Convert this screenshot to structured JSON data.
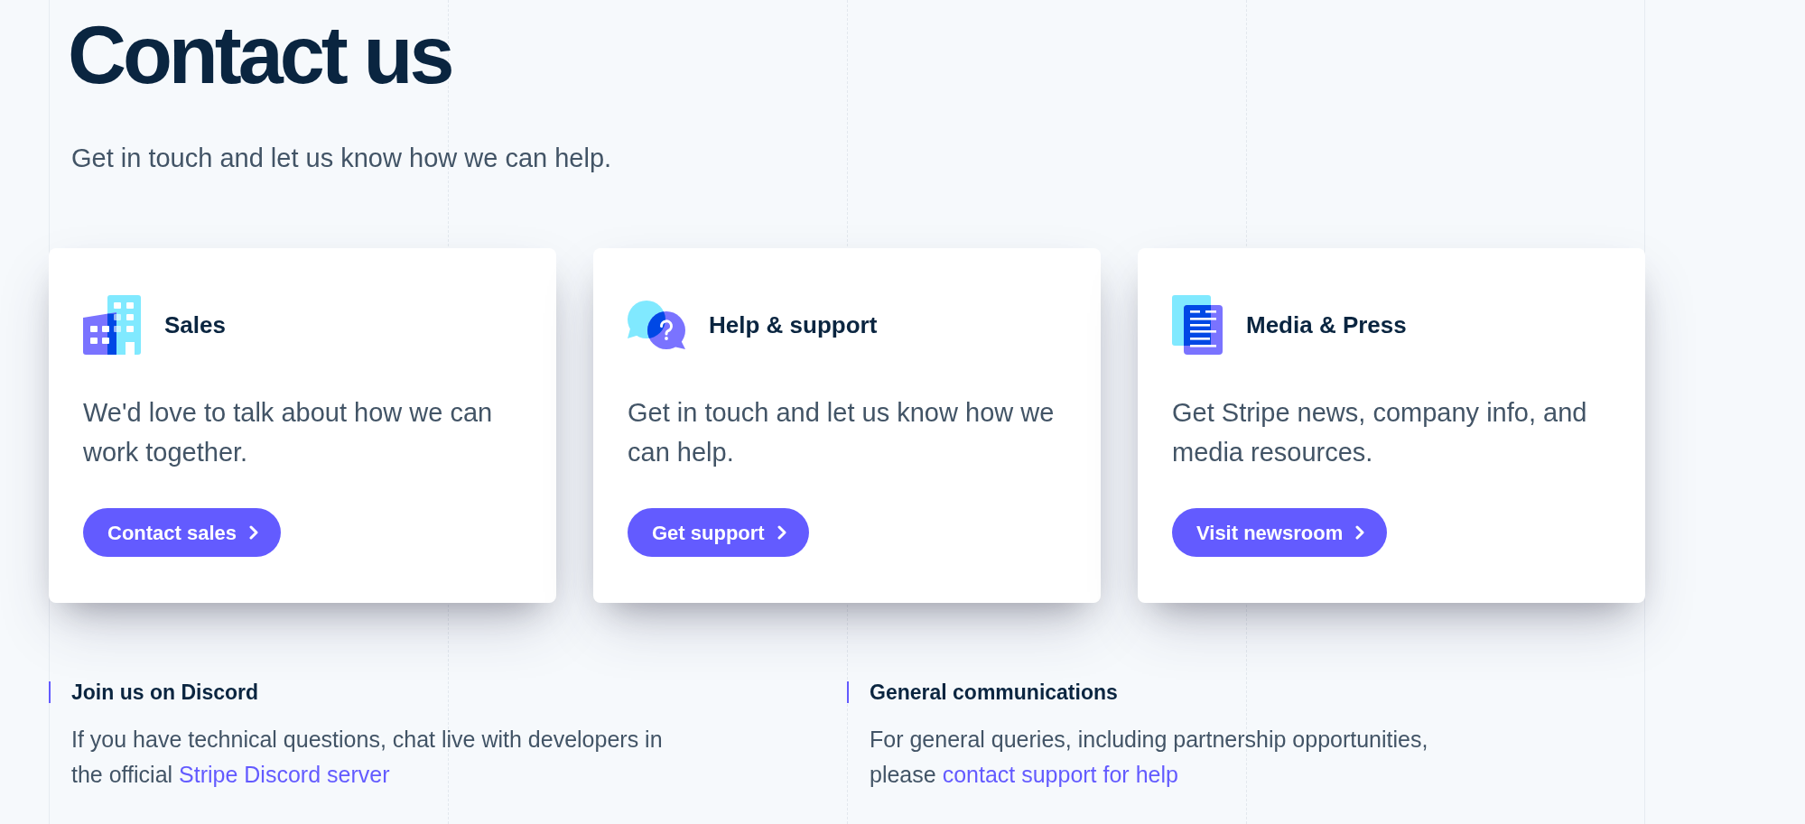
{
  "header": {
    "title": "Contact us",
    "subtitle": "Get in touch and let us know how we can help."
  },
  "cards": [
    {
      "title": "Sales",
      "description": "We'd love to talk about how we can work together.",
      "button": "Contact sales"
    },
    {
      "title": "Help & support",
      "description": "Get in touch and let us know how we can help.",
      "button": "Get support"
    },
    {
      "title": "Media & Press",
      "description": "Get Stripe news, company info, and media resources.",
      "button": "Visit newsroom"
    }
  ],
  "info_sections": [
    {
      "title": "Join us on Discord",
      "text": "If you have technical questions, chat live with developers in the official",
      "link": "Stripe Discord server"
    },
    {
      "title": "General communications",
      "text": "For general queries, including partnership opportunities, please",
      "link": "contact support for help"
    }
  ]
}
